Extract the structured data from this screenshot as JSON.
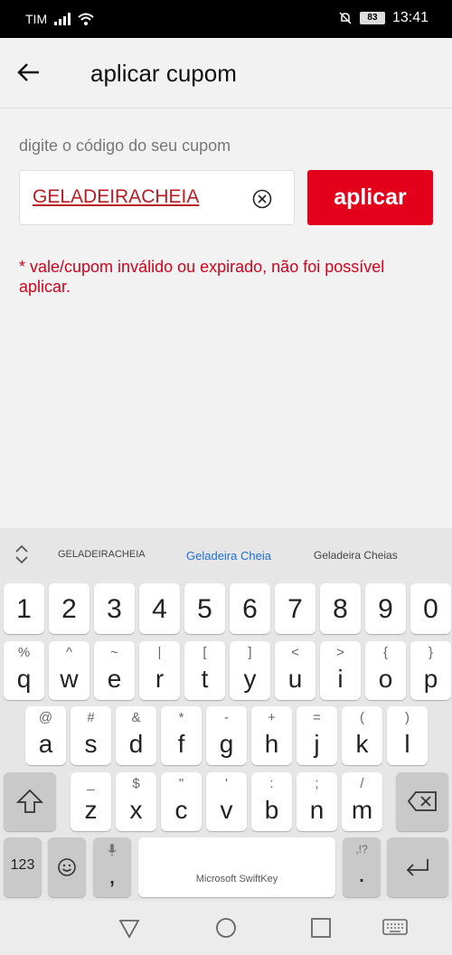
{
  "status_bar": {
    "carrier": "TIM",
    "battery": "83",
    "time": "13:41",
    "icons": [
      "signal-icon",
      "wifi-icon",
      "mute-bell-icon",
      "battery-icon"
    ]
  },
  "app_bar": {
    "title": "aplicar cupom",
    "back_icon": "arrow-left-icon"
  },
  "coupon": {
    "label": "digite o código do seu cupom",
    "value": "GELADEIRACHEIA",
    "clear_icon": "clear-circle-icon",
    "apply_label": "aplicar",
    "error": "* vale/cupom inválido ou expirado, não foi possível aplicar."
  },
  "keyboard": {
    "suggestions": [
      "GELADEIRACHEIA",
      "Geladeira Cheia",
      "Geladeira Cheias"
    ],
    "numbers": [
      "1",
      "2",
      "3",
      "4",
      "5",
      "6",
      "7",
      "8",
      "9",
      "0"
    ],
    "row1": [
      {
        "k": "q",
        "a": "%"
      },
      {
        "k": "w",
        "a": "^"
      },
      {
        "k": "e",
        "a": "~"
      },
      {
        "k": "r",
        "a": "|"
      },
      {
        "k": "t",
        "a": "["
      },
      {
        "k": "y",
        "a": "]"
      },
      {
        "k": "u",
        "a": "<"
      },
      {
        "k": "i",
        "a": ">"
      },
      {
        "k": "o",
        "a": "{"
      },
      {
        "k": "p",
        "a": "}"
      }
    ],
    "row2": [
      {
        "k": "a",
        "a": "@"
      },
      {
        "k": "s",
        "a": "#"
      },
      {
        "k": "d",
        "a": "&"
      },
      {
        "k": "f",
        "a": "*"
      },
      {
        "k": "g",
        "a": "-"
      },
      {
        "k": "h",
        "a": "+"
      },
      {
        "k": "j",
        "a": "="
      },
      {
        "k": "k",
        "a": "("
      },
      {
        "k": "l",
        "a": ")"
      }
    ],
    "row3": [
      {
        "k": "z",
        "a": "_"
      },
      {
        "k": "x",
        "a": "$"
      },
      {
        "k": "c",
        "a": "\""
      },
      {
        "k": "v",
        "a": "'"
      },
      {
        "k": "b",
        "a": ":"
      },
      {
        "k": "n",
        "a": ";"
      },
      {
        "k": "m",
        "a": "/"
      }
    ],
    "sym_label": "123",
    "comma": ",",
    "period": ".",
    "period_alt": ",!?",
    "space_label": "Microsoft SwiftKey",
    "accent": "#1f6fd0"
  },
  "colors": {
    "primary": "#e3001b",
    "error": "#d0021b"
  }
}
